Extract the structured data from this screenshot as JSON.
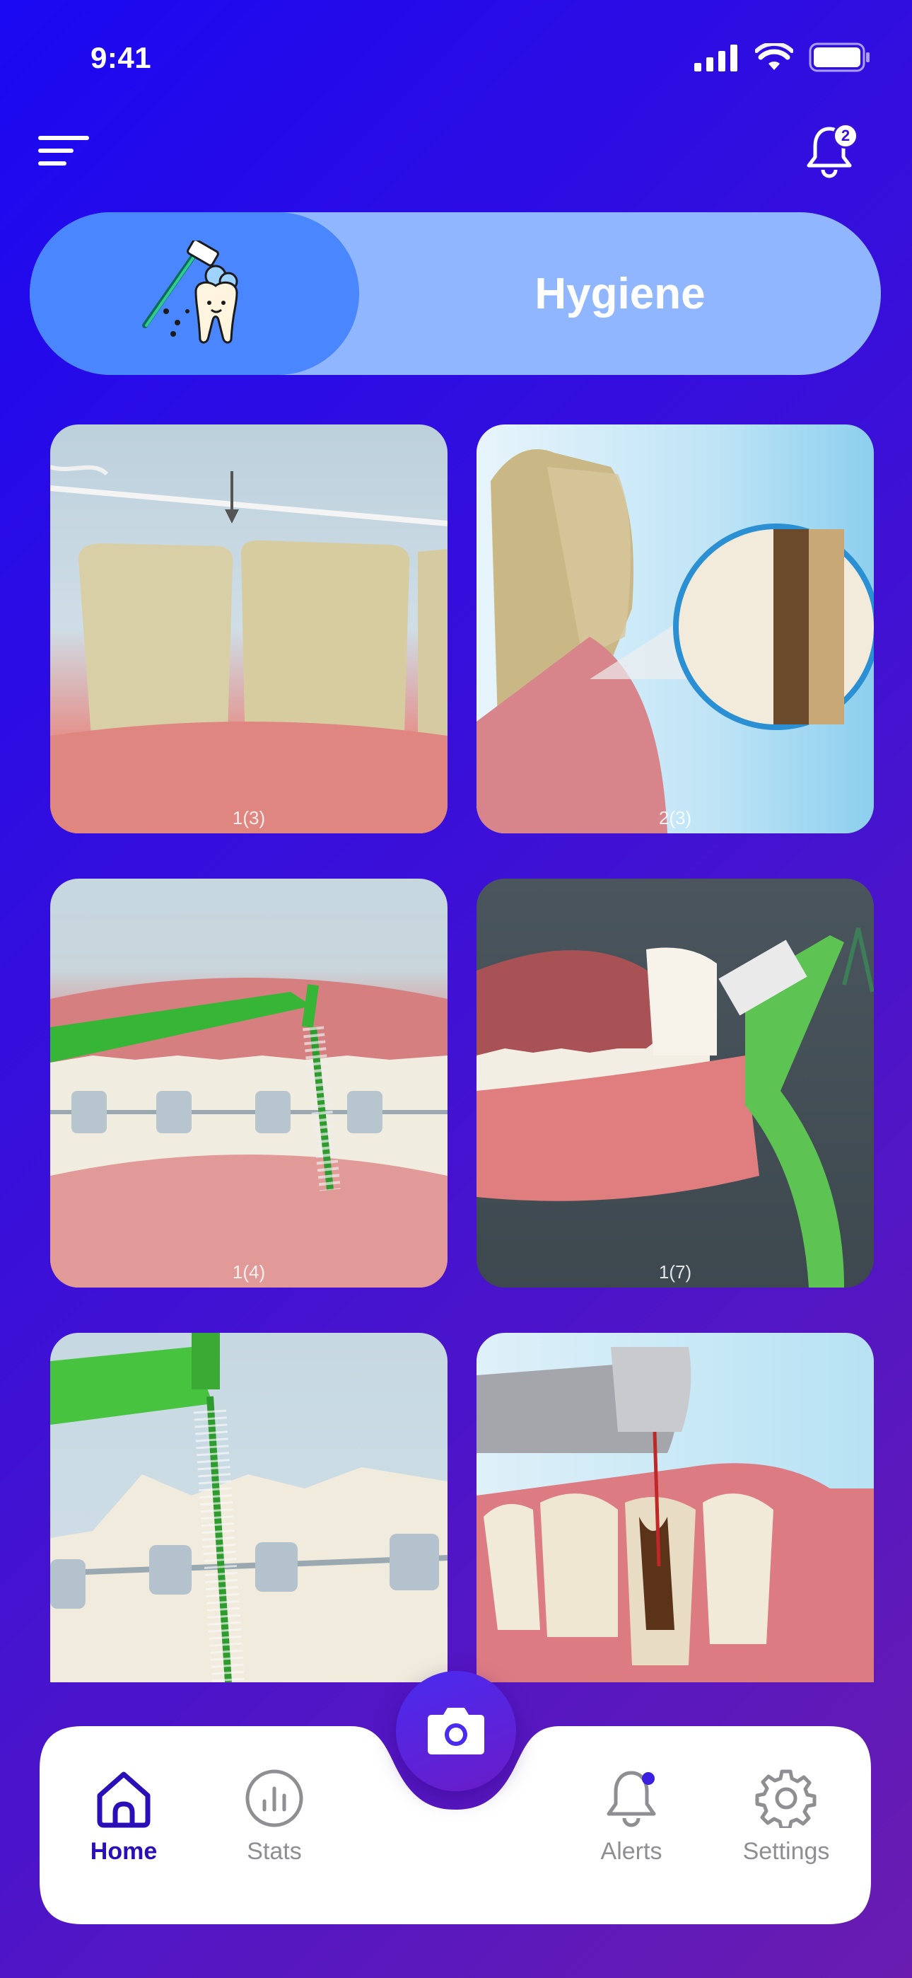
{
  "status_bar": {
    "time": "9:41"
  },
  "notifications": {
    "badge_count": "2"
  },
  "category": {
    "title": "Hygiene"
  },
  "cards": [
    {
      "caption": "1(3)"
    },
    {
      "caption": "2(3)"
    },
    {
      "caption": "1(4)"
    },
    {
      "caption": "1(7)"
    },
    {
      "caption": ""
    },
    {
      "caption": ""
    }
  ],
  "tabbar": {
    "home_label": "Home",
    "stats_label": "Stats",
    "alerts_label": "Alerts",
    "settings_label": "Settings",
    "camera_icon": "camera-icon"
  },
  "colors": {
    "background_start": "#1a08f2",
    "background_end": "#6a1cb0",
    "pill": "#8fb6ff",
    "pill_icon_bg": "#4a87ff",
    "active_tab": "#2a0fb8"
  }
}
